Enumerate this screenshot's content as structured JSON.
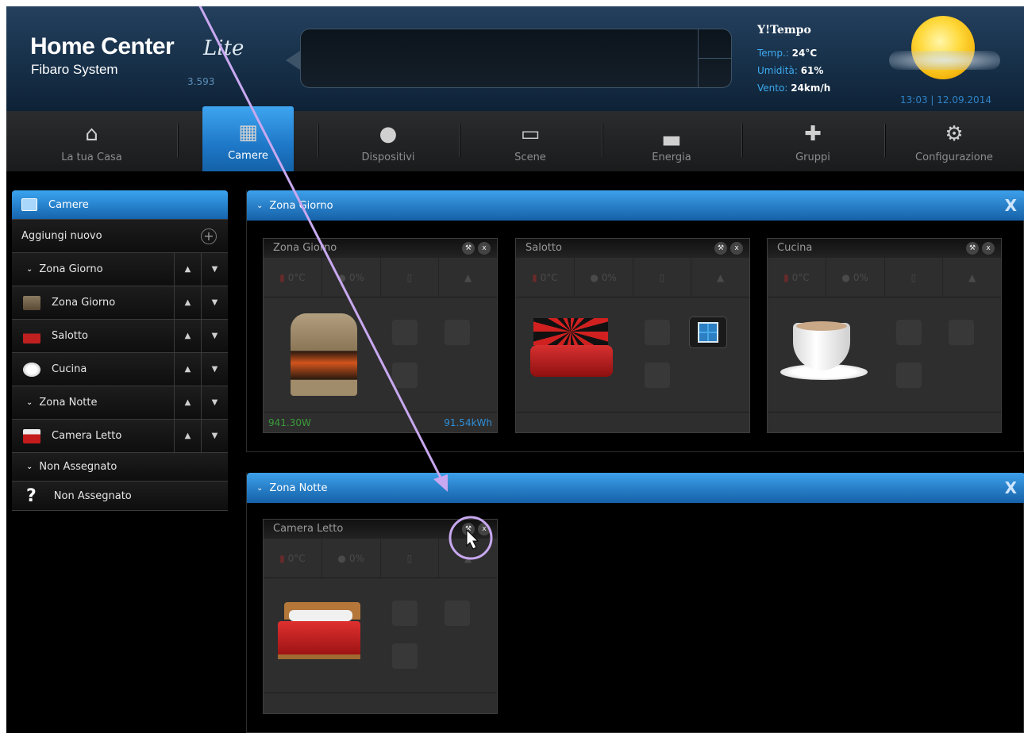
{
  "header": {
    "logo_title": "Home Center",
    "logo_subtitle": "Fibaro System",
    "logo_lite": "Lite",
    "version": "3.593",
    "weather": {
      "provider": "Tempo",
      "temp_label": "Temp.:",
      "temp_value": "24°C",
      "humidity_label": "Umidità:",
      "humidity_value": "61%",
      "wind_label": "Vento:",
      "wind_value": "24km/h"
    },
    "datetime": "13:03 | 12.09.2014"
  },
  "nav": {
    "items": [
      {
        "label": "La tua Casa",
        "icon": "house-icon"
      },
      {
        "label": "Camere",
        "icon": "rooms-icon"
      },
      {
        "label": "Dispositivi",
        "icon": "lightbulb-icon"
      },
      {
        "label": "Scene",
        "icon": "clapperboard-icon"
      },
      {
        "label": "Energia",
        "icon": "bar-chart-icon"
      },
      {
        "label": "Gruppi",
        "icon": "puzzle-icon"
      },
      {
        "label": "Configurazione",
        "icon": "gears-icon"
      }
    ],
    "active": "Camere"
  },
  "sidebar": {
    "title": "Camere",
    "add_new": "Aggiungi nuovo",
    "rows": [
      {
        "type": "section",
        "label": "Zona Giorno"
      },
      {
        "type": "room",
        "label": "Zona Giorno",
        "icon": "fireplace-icon"
      },
      {
        "type": "room",
        "label": "Salotto",
        "icon": "sofa-icon"
      },
      {
        "type": "room",
        "label": "Cucina",
        "icon": "coffee-cup-icon"
      },
      {
        "type": "section",
        "label": "Zona Notte"
      },
      {
        "type": "room",
        "label": "Camera Letto",
        "icon": "bed-icon"
      },
      {
        "type": "section",
        "label": "Non Assegnato"
      },
      {
        "type": "room",
        "label": "Non Assegnato",
        "icon": "question-icon"
      }
    ]
  },
  "zones": [
    {
      "title": "Zona Giorno",
      "close": "X",
      "rooms": [
        {
          "title": "Zona Giorno",
          "temp": "0°C",
          "humidity": "0%",
          "power": "941.30W",
          "energy": "91.54kWh"
        },
        {
          "title": "Salotto",
          "temp": "0°C",
          "humidity": "0%",
          "power": "",
          "energy": ""
        },
        {
          "title": "Cucina",
          "temp": "0°C",
          "humidity": "0%",
          "power": "",
          "energy": ""
        }
      ]
    },
    {
      "title": "Zona Notte",
      "close": "X",
      "rooms": [
        {
          "title": "Camera Letto",
          "temp": "0°C",
          "humidity": "0%",
          "power": "",
          "energy": ""
        }
      ]
    }
  ],
  "room_tools": {
    "settings": "wrench-icon",
    "delete": "x"
  },
  "colors": {
    "accent_blue": "#1e78c8",
    "power_green": "#3a9a3a",
    "energy_blue": "#2e8fd8",
    "annotation": "#c8a8f0"
  }
}
